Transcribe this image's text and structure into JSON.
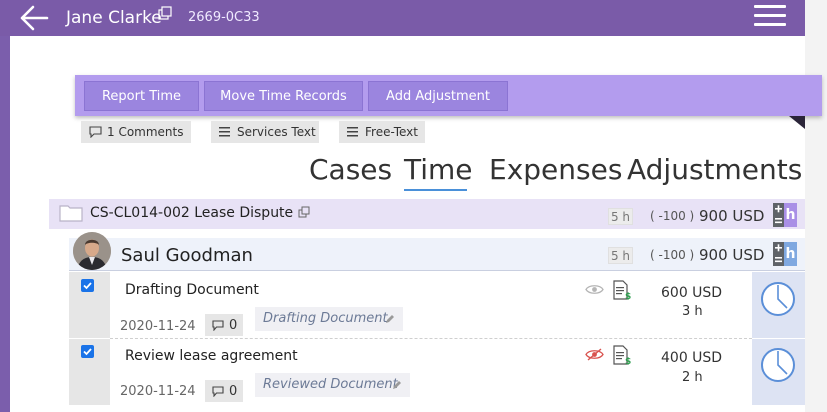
{
  "header": {
    "client_name": "Jane Clarke",
    "client_code": "2669-0C33",
    "icons": {
      "back": "arrow-left-icon",
      "open": "external-link-icon",
      "menu": "hamburger-menu-icon"
    }
  },
  "actions": [
    {
      "label": "Report Time"
    },
    {
      "label": "Move Time Records"
    },
    {
      "label": "Add Adjustment"
    }
  ],
  "chips": [
    {
      "label": "1 Comments",
      "icon": "comment-icon"
    },
    {
      "label": "Services Text",
      "icon": "list-icon"
    },
    {
      "label": "Free-Text",
      "icon": "list-icon"
    }
  ],
  "tabs": [
    {
      "label": "Cases",
      "active": false
    },
    {
      "label": "Time",
      "active": true
    },
    {
      "label": "Expenses",
      "active": false
    },
    {
      "label": "Adjustments",
      "active": false
    }
  ],
  "case": {
    "title": "CS-CL014-002 Lease Dispute",
    "hours": "5 h",
    "adjustment": "( -100 )",
    "amount": "900 USD",
    "hour_badge": "h",
    "icons": {
      "folder": "folder-icon",
      "calculator": "calculator-icon"
    }
  },
  "employee": {
    "name": "Saul Goodman",
    "hours": "5 h",
    "adjustment": "( -100 )",
    "amount": "900 USD",
    "hour_badge": "h",
    "icons": {
      "avatar": "avatar-photo"
    }
  },
  "records": [
    {
      "title": "Drafting Document",
      "date": "2020-11-24",
      "comments": "0",
      "description": "Drafting Document",
      "amount": "600 USD",
      "hours": "3 h",
      "checked": true,
      "visible": true
    },
    {
      "title": "Review lease agreement",
      "date": "2020-11-24",
      "comments": "0",
      "description": "Reviewed Document",
      "amount": "400 USD",
      "hours": "2 h",
      "checked": true,
      "visible": false
    }
  ],
  "colors": {
    "topbar": "#7a5ba8",
    "toolbar": "#b39cee",
    "button": "#9b85df",
    "case_row": "#e8e2f6",
    "employee_row": "#eef2fa",
    "accent_blue": "#4a90d9",
    "hour_badge_case": "#a98fe6",
    "hour_badge_employee": "#7fa8e0",
    "billable_green": "#2e9e4f",
    "hidden_red": "#d9534f"
  }
}
